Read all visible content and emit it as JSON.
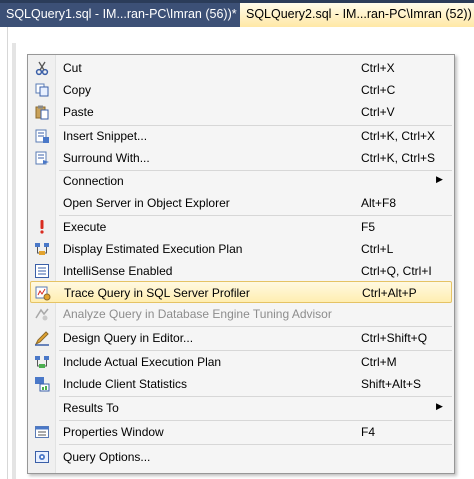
{
  "tabs": [
    {
      "label": "SQLQuery1.sql - IM...ran-PC\\Imran (56))*"
    },
    {
      "label": "SQLQuery2.sql - IM...ran-PC\\Imran (52))"
    }
  ],
  "menu": {
    "items": [
      {
        "label": "Cut",
        "shortcut": "Ctrl+X",
        "icon": "scissors-icon"
      },
      {
        "label": "Copy",
        "shortcut": "Ctrl+C",
        "icon": "copy-icon"
      },
      {
        "label": "Paste",
        "shortcut": "Ctrl+V",
        "icon": "paste-icon"
      },
      {
        "label": "Insert Snippet...",
        "shortcut": "Ctrl+K, Ctrl+X",
        "icon": "insert-snippet-icon"
      },
      {
        "label": "Surround With...",
        "shortcut": "Ctrl+K, Ctrl+S",
        "icon": "surround-with-icon"
      },
      {
        "label": "Connection",
        "shortcut": "",
        "submenu_arrow": "▶"
      },
      {
        "label": "Open Server in Object Explorer",
        "shortcut": "Alt+F8"
      },
      {
        "label": "Execute",
        "shortcut": "F5",
        "icon": "execute-icon"
      },
      {
        "label": "Display Estimated Execution Plan",
        "shortcut": "Ctrl+L",
        "icon": "estimated-plan-icon"
      },
      {
        "label": "IntelliSense Enabled",
        "shortcut": "Ctrl+Q, Ctrl+I",
        "icon": "intellisense-icon"
      },
      {
        "label": "Trace Query in SQL Server Profiler",
        "shortcut": "Ctrl+Alt+P",
        "icon": "profiler-icon",
        "highlighted": true
      },
      {
        "label": "Analyze Query in Database Engine Tuning Advisor",
        "shortcut": "",
        "icon": "tuning-advisor-icon",
        "disabled": true
      },
      {
        "label": "Design Query in Editor...",
        "shortcut": "Ctrl+Shift+Q",
        "icon": "design-query-icon"
      },
      {
        "label": "Include Actual Execution Plan",
        "shortcut": "Ctrl+M",
        "icon": "actual-plan-icon"
      },
      {
        "label": "Include Client Statistics",
        "shortcut": "Shift+Alt+S",
        "icon": "client-statistics-icon"
      },
      {
        "label": "Results To",
        "shortcut": "",
        "submenu_arrow": "▶"
      },
      {
        "label": "Properties Window",
        "shortcut": "F4",
        "icon": "properties-icon"
      },
      {
        "label": "Query Options...",
        "shortcut": "",
        "icon": "query-options-icon"
      }
    ]
  },
  "colors": {
    "tab_strip": "#2b3c59",
    "highlight_border": "#e5c365",
    "highlight_fill": "#ffeeb1"
  }
}
